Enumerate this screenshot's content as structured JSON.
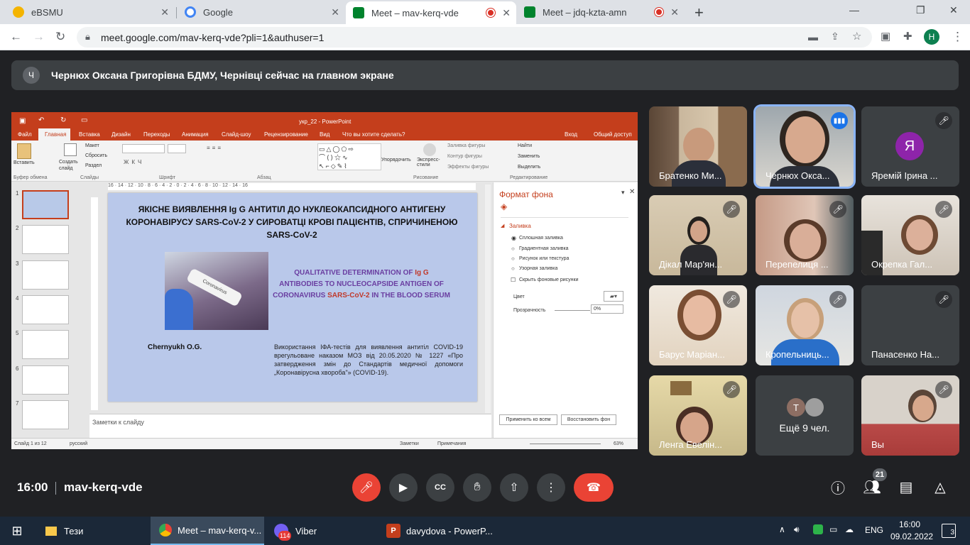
{
  "browser": {
    "tabs": [
      {
        "title": "eBSMU",
        "favicon_color": "#f4b400"
      },
      {
        "title": "Google",
        "favicon_color": "#4285f4"
      },
      {
        "title": "Meet – mav-kerq-vde",
        "favicon_color": "#00832d"
      },
      {
        "title": "Meet – jdq-kzta-amn",
        "favicon_color": "#00832d"
      }
    ],
    "new_tab": "+",
    "url": "meet.google.com/mav-kerq-vde?pli=1&authuser=1",
    "profile_letter": "H",
    "window_controls": {
      "minimize": "—",
      "maximize": "❐",
      "close": "✕"
    }
  },
  "meet": {
    "banner_avatar": "Ч",
    "banner_text": "Чернюх Оксана Григорівна БДМУ, Чернівці сейчас на главном экране",
    "participants": [
      {
        "name": "Братенко Ми...",
        "muted": false
      },
      {
        "name": "Чернюх Окса...",
        "muted": false,
        "speaking": true
      },
      {
        "name": "Яремій Ірина ...",
        "muted": true,
        "avatar_letter": "Я",
        "avatar_color": "#8e24aa"
      },
      {
        "name": "Дікал Мар'ян...",
        "muted": true
      },
      {
        "name": "Перепелиця ...",
        "muted": true
      },
      {
        "name": "Окрепка Гал...",
        "muted": true
      },
      {
        "name": "Барус Маріан...",
        "muted": true
      },
      {
        "name": "Кропельниць...",
        "muted": true
      },
      {
        "name": "Панасенко На...",
        "muted": true
      },
      {
        "name": "Ленга Евелін...",
        "muted": true
      },
      {
        "name": "Ещё 9 чел.",
        "muted": false,
        "avatar_letter": "T"
      },
      {
        "name": "Вы",
        "muted": true
      }
    ],
    "time": "16:00",
    "meeting_code": "mav-kerq-vde",
    "people_count": "21",
    "controls": [
      "mic-off",
      "camera",
      "captions",
      "raise-hand",
      "present",
      "more",
      "end-call"
    ]
  },
  "ppt": {
    "title": "укр_22 - PowerPoint",
    "ribbon_tabs": [
      "Файл",
      "Главная",
      "Вставка",
      "Дизайн",
      "Переходы",
      "Анимация",
      "Слайд-шоу",
      "Рецензирование",
      "Вид"
    ],
    "tell_me": "Что вы хотите сделать?",
    "sign_in": "Вход",
    "share": "Общий доступ",
    "groups": [
      "Буфер обмена",
      "Слайды",
      "Шрифт",
      "Абзац",
      "Рисование",
      "Редактирование"
    ],
    "buttons": {
      "paste": "Вставить",
      "new_slide": "Создать слайд",
      "layout": "Макет",
      "reset": "Сбросить",
      "section": "Раздел",
      "arrange": "Упорядочить",
      "quick_styles": "Экспресс-стили",
      "fill": "Заливка фигуры",
      "outline": "Контур фигуры",
      "effects": "Эффекты фигуры",
      "find": "Найти",
      "replace": "Заменить",
      "select": "Выделить"
    },
    "ruler": "16 · 14 · 12 · 10 · 8 · 6 · 4 · 2 · 0 · 2 · 4 · 6 · 8 · 10 · 12 · 14 · 16",
    "slide_numbers": [
      "1",
      "2",
      "3",
      "4",
      "5",
      "6",
      "7"
    ],
    "slide": {
      "title_ua": "ЯКІСНЕ ВИЯВЛЕННЯ Ig G АНТИТІЛ ДО НУКЛЕОКАПСИДНОГО АНТИГЕНУ КОРОНАВІРУСУ SARS-CoV-2 У СИРОВАТЦІ КРОВІ ПАЦІЄНТІВ, СПРИЧИНЕНОЮ SARS-CoV-2",
      "en_line1": "QUALITATIVE DETERMINATION OF ",
      "en_igg": "Ig G",
      "en_line2": " ANTIBODIES TO NUCLEOCAPSIDE ANTIGEN OF CORONAVIRUS ",
      "en_sars": "SARS-CoV-2",
      "en_line3": " IN THE BLOOD SERUM",
      "author": "Chernyukh O.G.",
      "body": "Використання ІФА-тестів для виявлення антитіл COVID-19 врегульоване наказом МОЗ від 20.05.2020 № 1227 «Про затвердження змін до Стандартів медичної допомоги „Коронавірусна хвороба\"» (COVID-19).",
      "tube_label": "Coronavirus"
    },
    "notes": "Заметки к слайду",
    "pane": {
      "title": "Формат фона",
      "section": "Заливка",
      "options": [
        "Сплошная заливка",
        "Градиентная заливка",
        "Рисунок или текстура",
        "Узорная заливка"
      ],
      "hide_bg": "Скрыть фоновые рисунки",
      "color": "Цвет",
      "transparency": "Прозрачность",
      "transparency_value": "0%",
      "apply_all": "Применить ко всем",
      "reset_bg": "Восстановить фон"
    },
    "status": {
      "slide": "Слайд 1 из 12",
      "lang": "русский",
      "notes": "Заметки",
      "comments": "Примечания",
      "zoom": "63%"
    }
  },
  "taskbar": {
    "items": [
      "Тези",
      "Meet – mav-kerq-v...",
      "Viber",
      "davydova - PowerP..."
    ],
    "viber_badge": "114",
    "lang": "ENG",
    "time": "16:00",
    "date": "09.02.2022",
    "notif": "3"
  }
}
